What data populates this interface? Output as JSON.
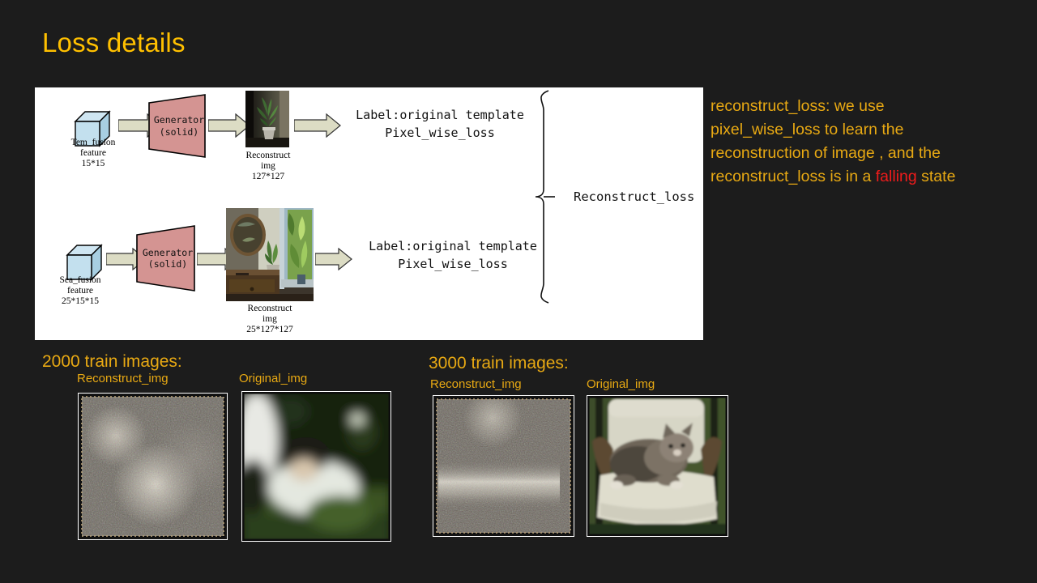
{
  "slide": {
    "title": "Loss details",
    "background_color": "#1c1c1c",
    "accent_color": "#ffc000",
    "note_color": "#e8a913",
    "highlight_color": "#ef1b1b"
  },
  "diagram": {
    "panel_background": "#ffffff",
    "rows": [
      {
        "input_caption": "Tem_fusion\nfeature\n15*15",
        "block_label_line1": "Generator",
        "block_label_line2": "(solid)",
        "output_caption": "Reconstruct\nimg\n127*127",
        "loss_text": "Label:original template\nPixel_wise_loss",
        "image_name": "potted-plant-photo"
      },
      {
        "input_caption": "Sea_fusion\nfeature\n25*15*15",
        "block_label_line1": "Generator",
        "block_label_line2": "(solid)",
        "output_caption": "Reconstruct\nimg\n25*127*127",
        "loss_text": "Label:original template\nPixel_wise_loss",
        "image_name": "room-window-mirror-photo"
      }
    ],
    "aggregate_label": "Reconstruct_loss",
    "cube_color": "#bfdceb",
    "generator_color": "#d49492",
    "arrow_color": "#dcdcc4"
  },
  "side_note": {
    "line1": "reconstruct_loss: we use",
    "line2": "pixel_wise_loss to learn the",
    "line3": "reconstruction of image , and the",
    "line4_prefix": "reconstruct_loss is in a ",
    "line4_highlight": "falling",
    "line4_suffix": " state"
  },
  "results": [
    {
      "heading": "2000 train images:",
      "reconstruct_label": "Reconstruct_img",
      "original_label": "Original_img",
      "reconstruct_image_name": "noisy-reconstruction-2000",
      "original_image_name": "blurry-person-in-garden-photo"
    },
    {
      "heading": "3000 train images:",
      "reconstruct_label": "Reconstruct_img",
      "original_label": "Original_img",
      "reconstruct_image_name": "noisy-reconstruction-3000",
      "original_image_name": "cat-on-chair-photo"
    }
  ]
}
